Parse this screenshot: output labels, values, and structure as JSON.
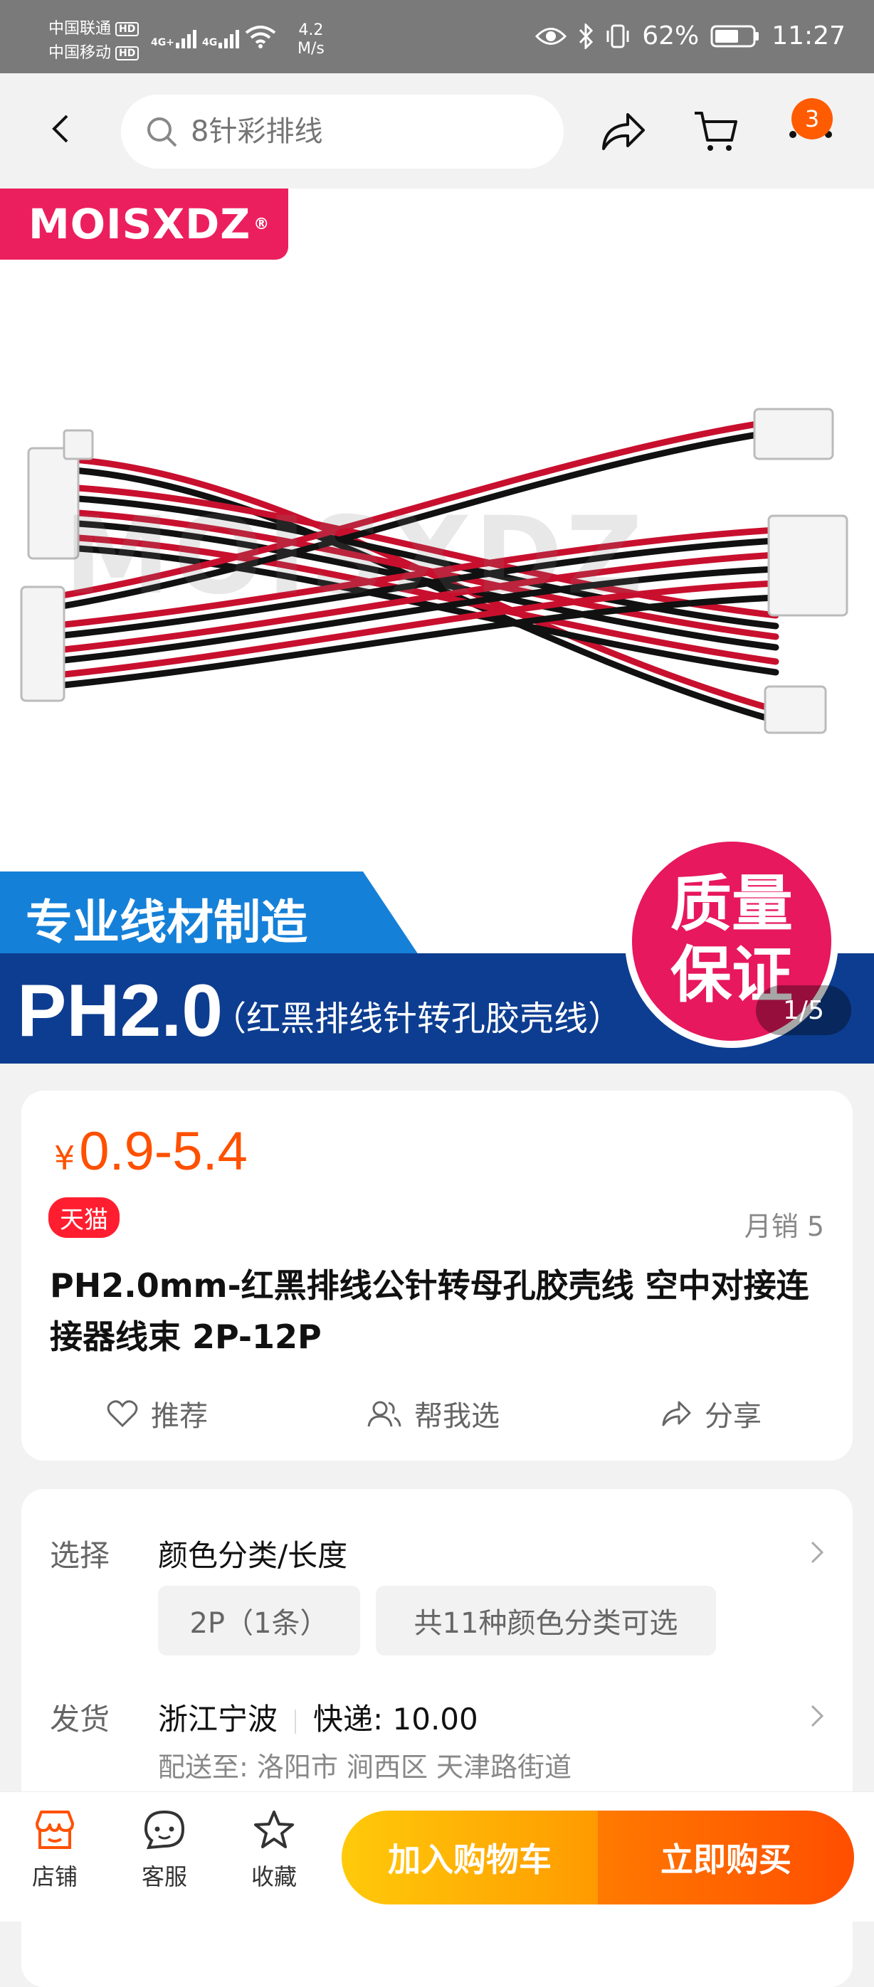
{
  "status_bar": {
    "carrier1": "中国联通",
    "carrier2": "中国移动",
    "hd": "HD",
    "net_type1": "4G+",
    "net_type2": "4G",
    "speed_value": "4.2",
    "speed_unit": "M/s",
    "battery": "62%",
    "time": "11:27"
  },
  "top_nav": {
    "search_placeholder": "8针彩排线",
    "cart_badge": "3"
  },
  "hero": {
    "brand": "MOISXDZ",
    "registered": "®",
    "watermark": "MOISXDZ",
    "banner_top": "专业线材制造",
    "banner_model": "PH2.0",
    "banner_sub": "（红黑排线针转孔胶壳线）",
    "quality_line1": "质量",
    "quality_line2": "保证",
    "pager": "1/5"
  },
  "product": {
    "currency": "¥",
    "price": "0.9-5.4",
    "store_badge": "天猫",
    "monthly_sales": "月销 5",
    "title": "PH2.0mm-红黑排线公针转母孔胶壳线 空中对接连接器线束 2P-12P",
    "actions": {
      "recommend": "推荐",
      "help_choose": "帮我选",
      "share": "分享"
    }
  },
  "options": {
    "select_label": "选择",
    "select_value": "颜色分类/长度",
    "chip1": "2P（1条）",
    "chip2": "共11种颜色分类可选",
    "ship_label": "发货",
    "ship_origin": "浙江宁波",
    "ship_fee": "快递: 10.00",
    "deliver_to": "配送至: 洛阳市 涧西区 天津路街道"
  },
  "bottom_bar": {
    "store": "店铺",
    "service": "客服",
    "favorite": "收藏",
    "add_to_cart": "加入购物车",
    "buy_now": "立即购买"
  },
  "colors": {
    "accent": "#ff5000",
    "brand_pink": "#ec1f5e",
    "banner_blue": "#1580d8",
    "banner_navy": "#0d3d90"
  }
}
